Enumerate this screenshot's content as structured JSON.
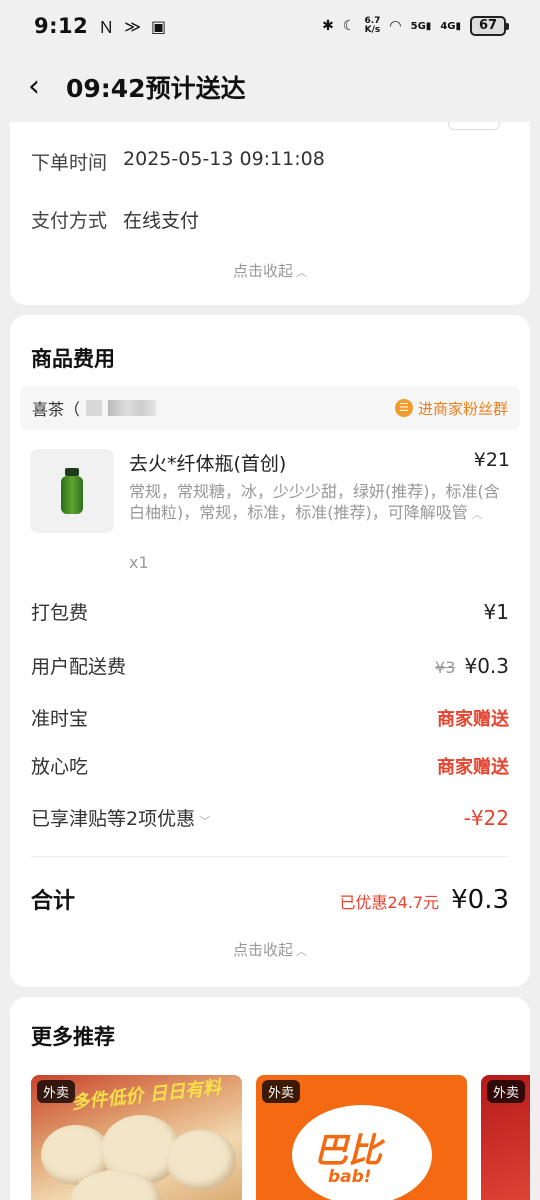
{
  "status_bar": {
    "time": "9:12",
    "net_speed_top": "6.7",
    "net_speed_unit": "K/s",
    "signal_1": "5G",
    "signal_2": "4G",
    "battery": "67"
  },
  "header": {
    "title": "09:42预计送达"
  },
  "order_info": {
    "order_time_label": "下单时间",
    "order_time_value": "2025-05-13 09:11:08",
    "payment_label": "支付方式",
    "payment_value": "在线支付",
    "collapse_label": "点击收起"
  },
  "goods": {
    "section_title": "商品费用",
    "store_name": "喜茶（",
    "fan_group_label": "进商家粉丝群",
    "product": {
      "name": "去火*纤体瓶(首创)",
      "price": "¥21",
      "spec": "常规，常规糖，冰，少少少甜，绿妍(推荐)，标准(含白柚粒)，常规，标准，标准(推荐)，可降解吸管",
      "qty": "x1"
    },
    "fees": {
      "packing_label": "打包费",
      "packing_value": "¥1",
      "delivery_label": "用户配送费",
      "delivery_original": "¥3",
      "delivery_value": "¥0.3",
      "ontime_label": "准时宝",
      "ontime_value": "商家赠送",
      "safe_label": "放心吃",
      "safe_value": "商家赠送",
      "discount_label": "已享津贴等2项优惠",
      "discount_value": "-¥22"
    },
    "total": {
      "label": "合计",
      "saved": "已优惠24.7元",
      "value": "¥0.3"
    },
    "collapse_label": "点击收起"
  },
  "recommend": {
    "section_title": "更多推荐",
    "items": [
      {
        "badge": "外卖",
        "banner": "多件低价 日日有料"
      },
      {
        "badge": "外卖",
        "brand_cn": "巴比",
        "brand_en": "bab!"
      },
      {
        "badge": "外卖"
      }
    ]
  }
}
